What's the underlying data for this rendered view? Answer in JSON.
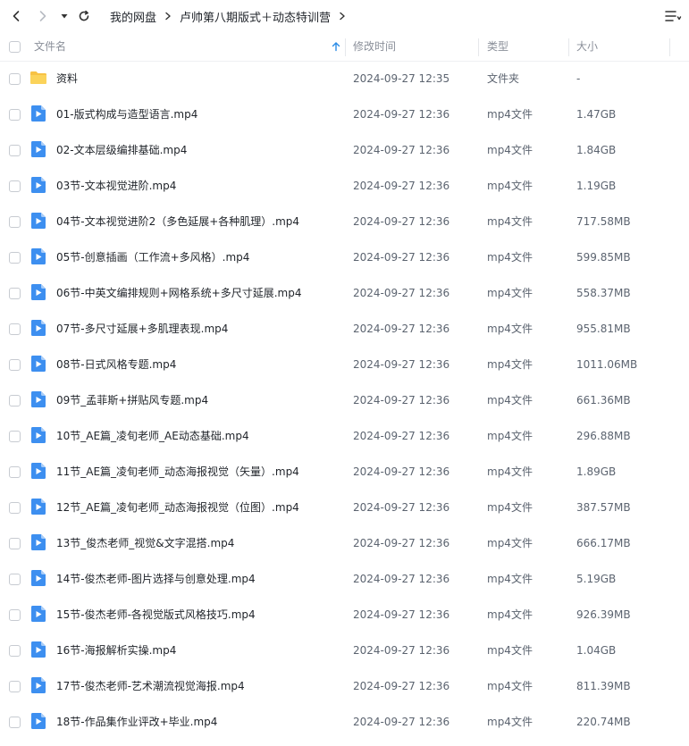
{
  "toolbar": {
    "breadcrumb": [
      "我的网盘",
      "卢帅第八期版式＋动态特训营"
    ]
  },
  "columns": {
    "name": "文件名",
    "modified": "修改时间",
    "type": "类型",
    "size": "大小"
  },
  "colors": {
    "accent": "#2b8ce6",
    "folder": "#f7c245",
    "video": "#3d8ff0"
  },
  "files": [
    {
      "icon": "folder-icon",
      "name": "资料",
      "modified": "2024-09-27 12:35",
      "type": "文件夹",
      "size": "-"
    },
    {
      "icon": "video-file-icon",
      "name": "01-版式构成与造型语言.mp4",
      "modified": "2024-09-27 12:36",
      "type": "mp4文件",
      "size": "1.47GB"
    },
    {
      "icon": "video-file-icon",
      "name": "02-文本层级编排基础.mp4",
      "modified": "2024-09-27 12:36",
      "type": "mp4文件",
      "size": "1.84GB"
    },
    {
      "icon": "video-file-icon",
      "name": "03节-文本视觉进阶.mp4",
      "modified": "2024-09-27 12:36",
      "type": "mp4文件",
      "size": "1.19GB"
    },
    {
      "icon": "video-file-icon",
      "name": "04节-文本视觉进阶2（多色延展+各种肌理）.mp4",
      "modified": "2024-09-27 12:36",
      "type": "mp4文件",
      "size": "717.58MB"
    },
    {
      "icon": "video-file-icon",
      "name": "05节-创意插画（工作流+多风格）.mp4",
      "modified": "2024-09-27 12:36",
      "type": "mp4文件",
      "size": "599.85MB"
    },
    {
      "icon": "video-file-icon",
      "name": "06节-中英文编排规则+网格系统+多尺寸延展.mp4",
      "modified": "2024-09-27 12:36",
      "type": "mp4文件",
      "size": "558.37MB"
    },
    {
      "icon": "video-file-icon",
      "name": "07节-多尺寸延展+多肌理表现.mp4",
      "modified": "2024-09-27 12:36",
      "type": "mp4文件",
      "size": "955.81MB"
    },
    {
      "icon": "video-file-icon",
      "name": "08节-日式风格专题.mp4",
      "modified": "2024-09-27 12:36",
      "type": "mp4文件",
      "size": "1011.06MB"
    },
    {
      "icon": "video-file-icon",
      "name": "09节_孟菲斯+拼贴风专题.mp4",
      "modified": "2024-09-27 12:36",
      "type": "mp4文件",
      "size": "661.36MB"
    },
    {
      "icon": "video-file-icon",
      "name": "10节_AE篇_凌旬老师_AE动态基础.mp4",
      "modified": "2024-09-27 12:36",
      "type": "mp4文件",
      "size": "296.88MB"
    },
    {
      "icon": "video-file-icon",
      "name": "11节_AE篇_凌旬老师_动态海报视觉（矢量）.mp4",
      "modified": "2024-09-27 12:36",
      "type": "mp4文件",
      "size": "1.89GB"
    },
    {
      "icon": "video-file-icon",
      "name": "12节_AE篇_凌旬老师_动态海报视觉（位图）.mp4",
      "modified": "2024-09-27 12:36",
      "type": "mp4文件",
      "size": "387.57MB"
    },
    {
      "icon": "video-file-icon",
      "name": "13节_俊杰老师_视觉&文字混搭.mp4",
      "modified": "2024-09-27 12:36",
      "type": "mp4文件",
      "size": "666.17MB"
    },
    {
      "icon": "video-file-icon",
      "name": "14节-俊杰老师-图片选择与创意处理.mp4",
      "modified": "2024-09-27 12:36",
      "type": "mp4文件",
      "size": "5.19GB"
    },
    {
      "icon": "video-file-icon",
      "name": "15节-俊杰老师-各视觉版式风格技巧.mp4",
      "modified": "2024-09-27 12:36",
      "type": "mp4文件",
      "size": "926.39MB"
    },
    {
      "icon": "video-file-icon",
      "name": "16节-海报解析实操.mp4",
      "modified": "2024-09-27 12:36",
      "type": "mp4文件",
      "size": "1.04GB"
    },
    {
      "icon": "video-file-icon",
      "name": "17节-俊杰老师-艺术潮流视觉海报.mp4",
      "modified": "2024-09-27 12:36",
      "type": "mp4文件",
      "size": "811.39MB"
    },
    {
      "icon": "video-file-icon",
      "name": "18节-作品集作业评改+毕业.mp4",
      "modified": "2024-09-27 12:36",
      "type": "mp4文件",
      "size": "220.74MB"
    }
  ]
}
